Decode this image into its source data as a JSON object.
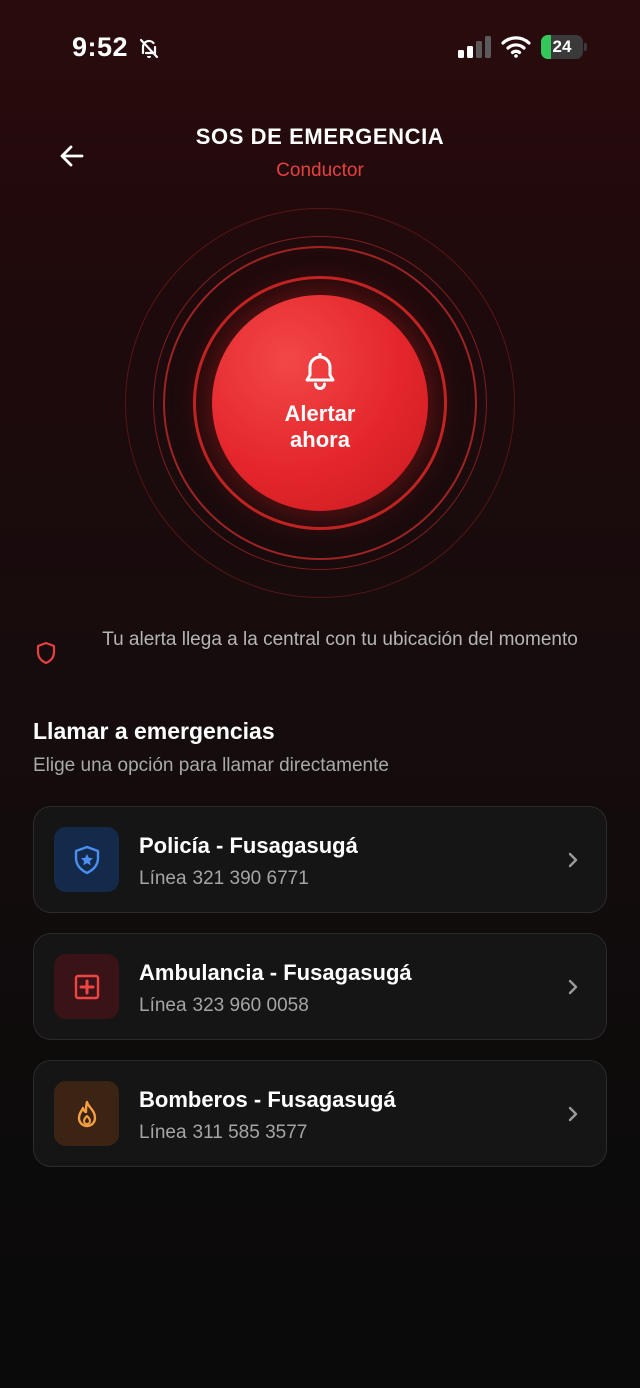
{
  "status_bar": {
    "time": "9:52",
    "battery_level": "24",
    "battery_fraction": 0.24,
    "icons": [
      "bell-off-icon",
      "signal-icon",
      "wifi-icon",
      "battery-charging-icon"
    ]
  },
  "header": {
    "title": "SOS DE EMERGENCIA",
    "subtitle": "Conductor",
    "back_icon": "arrow-left-icon"
  },
  "sos_button": {
    "label": "Alertar ahora",
    "icon": "bell-icon"
  },
  "info": {
    "text": "Tu alerta llega a la central con tu ubicación del momento",
    "icon": "shield-icon"
  },
  "emergency_section": {
    "title": "Llamar a emergencias",
    "subtitle": "Elige una opción para llamar directamente"
  },
  "contacts": [
    {
      "name": "Policía - Fusagasugá",
      "line_label": "Línea",
      "number": "321 390 6771",
      "icon": "police-badge-icon",
      "accent": "#4b8ef1"
    },
    {
      "name": "Ambulancia - Fusagasugá",
      "line_label": "Línea",
      "number": "323 960 0058",
      "icon": "medical-cross-icon",
      "accent": "#ef4444"
    },
    {
      "name": "Bomberos - Fusagasugá",
      "line_label": "Línea",
      "number": "311 585 3577",
      "icon": "flame-icon",
      "accent": "#f59e42"
    }
  ],
  "colors": {
    "accent_red": "#e5413f",
    "sos_red": "#e4262b",
    "card_bg": "#151515"
  }
}
